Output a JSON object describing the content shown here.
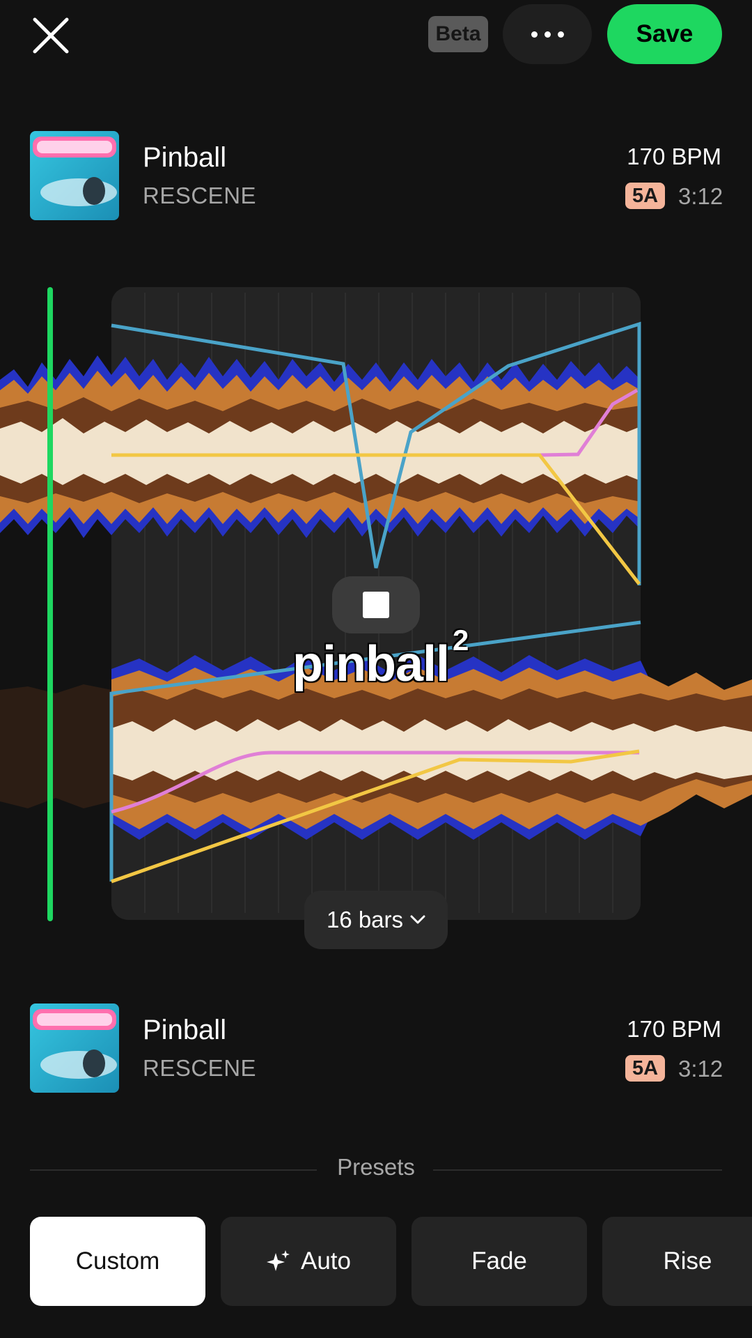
{
  "header": {
    "close_icon": "close-icon",
    "beta_label": "Beta",
    "more_icon": "more-horizontal-icon",
    "save_label": "Save"
  },
  "tracks": [
    {
      "title": "Pinball",
      "artist": "RESCENE",
      "bpm": "170 BPM",
      "key": "5A",
      "duration": "3:12",
      "cover_icon": "album-cover"
    },
    {
      "title": "Pinball",
      "artist": "RESCENE",
      "bpm": "170 BPM",
      "key": "5A",
      "duration": "3:12",
      "cover_icon": "album-cover"
    }
  ],
  "editor": {
    "mix_title": "pinball",
    "mix_superscript": "2",
    "stop_icon": "stop-icon",
    "bars_label": "16 bars",
    "bars_icon": "chevron-down-icon",
    "colors": {
      "playhead": "#1ed760",
      "volume_line": "#4aa3c8",
      "eq_line_pink": "#e07fd6",
      "eq_line_yellow": "#f2c744",
      "wave_outer_blue": "#2633c4",
      "wave_mid_orange": "#c77b33",
      "wave_inner_brown": "#6e3b1c",
      "wave_core": "#f1e3cc"
    }
  },
  "presets": {
    "label": "Presets",
    "items": [
      {
        "label": "Custom",
        "active": true
      },
      {
        "label": "Auto",
        "icon": "sparkle-icon",
        "active": false
      },
      {
        "label": "Fade",
        "active": false
      },
      {
        "label": "Rise",
        "active": false
      }
    ]
  }
}
